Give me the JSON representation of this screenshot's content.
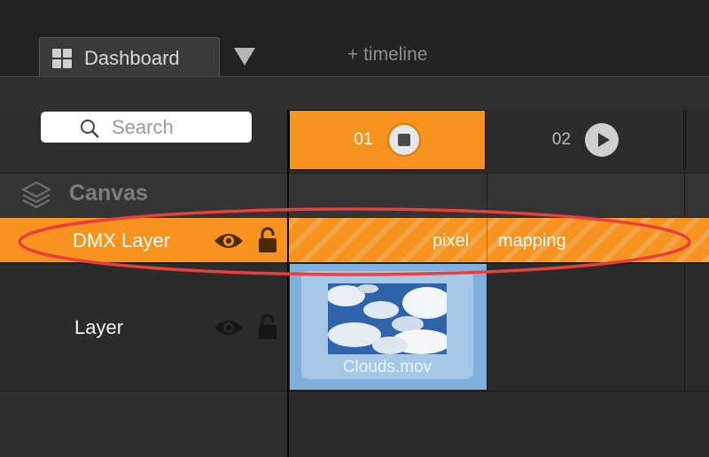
{
  "tabs": {
    "dashboard_label": "Dashboard",
    "add_timeline_label": "+ timeline"
  },
  "search": {
    "placeholder": "Search"
  },
  "clips": [
    {
      "number": "01",
      "state": "stop"
    },
    {
      "number": "02",
      "state": "play"
    }
  ],
  "canvas": {
    "label": "Canvas"
  },
  "layers": [
    {
      "name": "DMX Layer",
      "clip_text_left": "pixel",
      "clip_text_right": "mapping"
    },
    {
      "name": "Layer",
      "clip_name": "Clouds.mov"
    }
  ],
  "colors": {
    "accent": "#f7931e",
    "highlight_ellipse": "#e8403a",
    "clip_slot": "#7fb0dd"
  },
  "icons": [
    "grid-icon",
    "chevron-down-icon",
    "search-icon",
    "stop-icon",
    "play-icon",
    "layers-icon",
    "eye-icon",
    "lock-icon"
  ]
}
